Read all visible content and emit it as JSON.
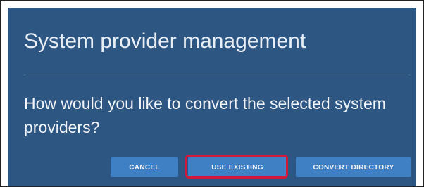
{
  "dialog": {
    "title": "System provider management",
    "message": "How would you like to convert the selected system providers?",
    "buttons": {
      "cancel": "CANCEL",
      "use_existing": "USE EXISTING",
      "convert_directory": "CONVERT DIRECTORY"
    },
    "highlighted_button": "use_existing"
  },
  "colors": {
    "dialog_background": "#2d5683",
    "button_background": "#3f7fc4",
    "highlight_border": "#d2193a",
    "text": "#f2f5f9"
  }
}
